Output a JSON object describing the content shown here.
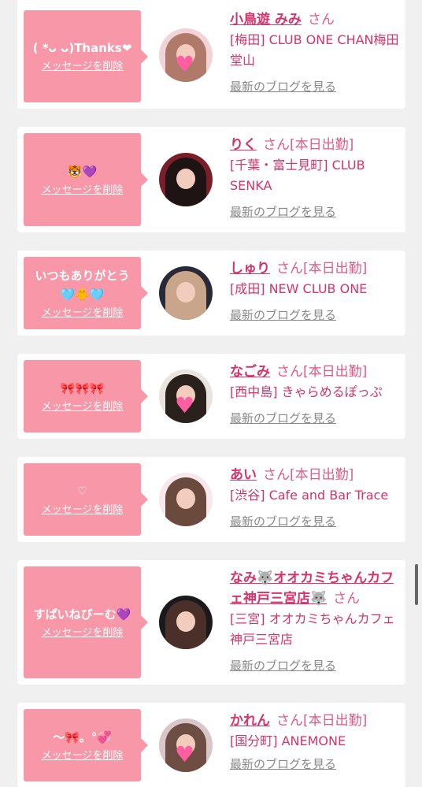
{
  "delete_label": "メッセージを削除",
  "blog_label": "最新のブログを見る",
  "san": "さん",
  "cards": [
    {
      "message": "( *ᴗ ᴗ)Thanks❤",
      "name": "小鳥遊 みみ",
      "duty": "",
      "shop": "[梅田] CLUB ONE CHAN梅田堂山",
      "avatar_colors": [
        "#f1d3d8",
        "#b07a6a"
      ],
      "avatar_mask": "heart"
    },
    {
      "message": "🐯💜",
      "name": "りく",
      "duty": "[本日出勤]",
      "shop": "[千葉・富士見町] CLUB SENKA",
      "avatar_colors": [
        "#7a1f2a",
        "#1e1414"
      ],
      "avatar_mask": ""
    },
    {
      "message": "いつもありがとう\n🩵🐥🩵",
      "name": "しゅり",
      "duty": "[本日出勤]",
      "shop": "[成田] NEW CLUB ONE",
      "avatar_colors": [
        "#2a2a36",
        "#c9a58c"
      ],
      "avatar_mask": ""
    },
    {
      "message": "🎀🎀🎀",
      "name": "なごみ",
      "duty": "[本日出勤]",
      "shop": "[西中島] きゃらめるぽっぷ",
      "avatar_colors": [
        "#e9e4df",
        "#2b211c"
      ],
      "avatar_mask": "heart"
    },
    {
      "message": "♡",
      "name": "あい",
      "duty": "[本日出勤]",
      "shop": "[渋谷] Cafe and Bar Trace",
      "avatar_colors": [
        "#f6e8ec",
        "#6b4a3e"
      ],
      "avatar_mask": ""
    },
    {
      "message": "すぱいねびーむ💜",
      "name": "なみ🐺オオカミちゃんカフェ神戸三宮店🐺",
      "duty": "",
      "shop": "[三宮] オオカミちゃんカフェ神戸三宮店",
      "avatar_colors": [
        "#1a1a1a",
        "#4a3029"
      ],
      "avatar_mask": ""
    },
    {
      "message": "〜🎀。°💞",
      "name": "かれん",
      "duty": "[本日出勤]",
      "shop": "[国分町] ANEMONE",
      "avatar_colors": [
        "#d8c6c9",
        "#6e4d42"
      ],
      "avatar_mask": "heart"
    }
  ]
}
